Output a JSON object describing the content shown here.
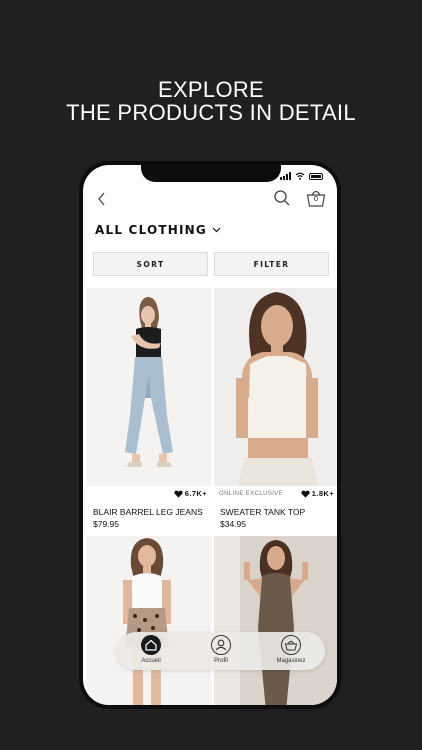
{
  "promo": {
    "line1": "EXPLORE",
    "line2": "THE PRODUCTS IN DETAIL"
  },
  "header": {
    "cart_count": "0",
    "category_title": "ALL CLOTHING"
  },
  "actions": {
    "sort_label": "SORT",
    "filter_label": "FILTER"
  },
  "products": [
    {
      "name": "BLAIR BARREL LEG JEANS",
      "price": "$79.95",
      "likes": "6.7K+",
      "badge": ""
    },
    {
      "name": "SWEATER TANK TOP",
      "price": "$34.95",
      "likes": "1.8K+",
      "badge": "ONLINE EXCLUSIVE"
    },
    {
      "name": "",
      "price": "",
      "likes": "",
      "badge": ""
    },
    {
      "name": "",
      "price": "",
      "likes": "",
      "badge": ""
    }
  ],
  "tabbar": {
    "items": [
      {
        "label": "Accueil",
        "icon": "home-icon",
        "active": true
      },
      {
        "label": "Profil",
        "icon": "profile-icon",
        "active": false
      },
      {
        "label": "Magasinez",
        "icon": "basket-icon",
        "active": false
      }
    ]
  },
  "colors": {
    "background": "#221f20",
    "phone_frame": "#0d0d0d",
    "button_bg": "#f3f3f3",
    "tabbar_bg": "#ece9e6"
  }
}
